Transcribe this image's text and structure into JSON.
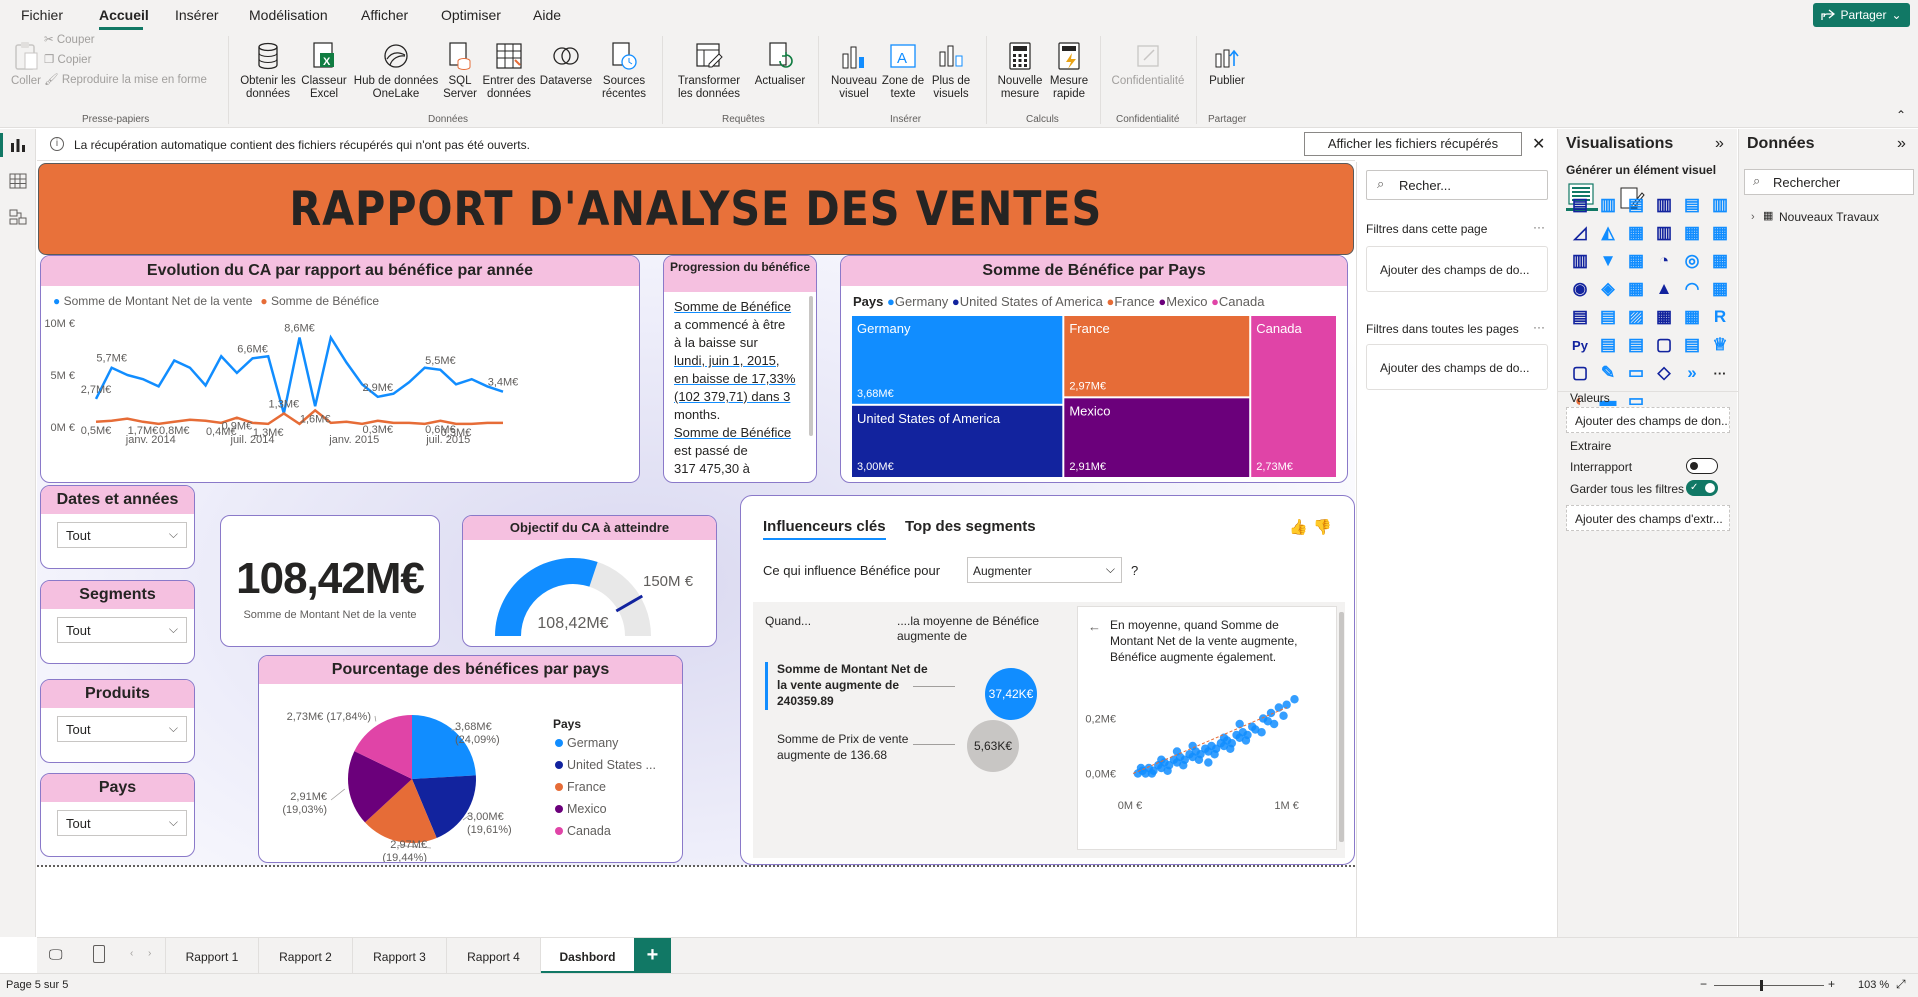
{
  "menu": {
    "items": [
      "Fichier",
      "Accueil",
      "Insérer",
      "Modélisation",
      "Afficher",
      "Optimiser",
      "Aide"
    ],
    "share": "Partager"
  },
  "ribbon": {
    "clipboard": {
      "paste": "Coller",
      "cut": "Couper",
      "copy": "Copier",
      "format_painter": "Reproduire la mise en forme",
      "group": "Presse-papiers"
    },
    "data": {
      "get_data": "Obtenir les données",
      "excel": "Classeur Excel",
      "onelake": "Hub de données OneLake",
      "sql": "SQL Server",
      "enter_data": "Entrer des données",
      "dataverse": "Dataverse",
      "recent": "Sources récentes",
      "group": "Données"
    },
    "queries": {
      "transform": "Transformer les données",
      "refresh": "Actualiser",
      "group": "Requêtes"
    },
    "insert": {
      "new_visual": "Nouveau visuel",
      "textbox": "Zone de texte",
      "more_visuals": "Plus de visuels",
      "group": "Insérer"
    },
    "calc": {
      "new_measure": "Nouvelle mesure",
      "quick_measure": "Mesure rapide",
      "group": "Calculs"
    },
    "sensitivity": {
      "label": "Confidentialité",
      "group": "Confidentialité"
    },
    "share": {
      "publish": "Publier",
      "group": "Partager"
    }
  },
  "notification": {
    "text": "La récupération automatique contient des fichiers récupérés qui n'ont pas été ouverts.",
    "button": "Afficher les fichiers récupérés"
  },
  "report": {
    "title": "RAPPORT D'ANALYSE DES VENTES",
    "line_chart": {
      "title": "Evolution du CA par rapport au bénéfice par année",
      "legend": [
        "Somme de Montant Net de la vente",
        "Somme de Bénéfice"
      ]
    },
    "narrative": {
      "title": "Progression du bénéfice",
      "lines": [
        "Somme de Bénéfice",
        "a commencé à être",
        "à la baisse sur",
        "lundi, juin 1, 2015,",
        "en baisse de 17,33%",
        "(102 379,71) dans 3",
        "months.",
        "Somme de Bénéfice",
        "est passé de",
        "317 475,30 à"
      ]
    },
    "treemap": {
      "title": "Somme de Bénéfice par Pays",
      "legend_title": "Pays"
    },
    "slicers": [
      {
        "title": "Dates et années",
        "value": "Tout"
      },
      {
        "title": "Segments",
        "value": "Tout"
      },
      {
        "title": "Produits",
        "value": "Tout"
      },
      {
        "title": "Pays",
        "value": "Tout"
      }
    ],
    "kpi": {
      "value": "108,42M€",
      "label": "Somme de Montant Net de la vente"
    },
    "gauge": {
      "title": "Objectif du CA à atteindre",
      "value_label": "108,42M€",
      "target_label": "150M €",
      "value": 108.42,
      "target": 150
    },
    "pie": {
      "title": "Pourcentage des bénéfices par pays",
      "legend_title": "Pays"
    },
    "influencers": {
      "tab1": "Influenceurs clés",
      "tab2": "Top des segments",
      "question": "Ce qui influence Bénéfice pour",
      "dropdown": "Augmenter",
      "help": "?",
      "col_when": "Quand...",
      "col_avg": "....la moyenne de Bénéfice augmente de",
      "factor1": "Somme de Montant Net de la vente augmente de 240359.89",
      "bubble1": "37,42K€",
      "factor2": "Somme de Prix de vente augmente de 136.68",
      "bubble2": "5,63K€",
      "detail": "En moyenne, quand Somme de Montant Net de la vente augmente, Bénéfice augmente également.",
      "y_ticks": [
        "0,2M€",
        "0,0M€"
      ],
      "x_ticks": [
        "0M €",
        "1M €"
      ]
    }
  },
  "chart_data": [
    {
      "type": "line",
      "title": "Evolution du CA par rapport au bénéfice par année",
      "x_ticks": [
        "janv. 2014",
        "juil. 2014",
        "janv. 2015",
        "juil. 2015"
      ],
      "y_ticks": [
        "10M €",
        "5M €",
        "0M €"
      ],
      "ylim": [
        0,
        10
      ],
      "series": [
        {
          "name": "Somme de Montant Net de la vente",
          "color": "#118dff",
          "values": [
            2.7,
            5.7,
            5.0,
            4.6,
            3.9,
            6.4,
            5.7,
            4.0,
            6.8,
            5.2,
            6.6,
            6.8,
            1.3,
            8.6,
            2.0,
            8.6,
            6.2,
            4.1,
            2.9,
            3.2,
            4.3,
            5.7,
            5.5,
            4.1,
            4.6,
            3.9,
            3.4
          ]
        },
        {
          "name": "Somme de Bénéfice",
          "color": "#e66c37",
          "values": [
            0.5,
            0.6,
            0.8,
            0.5,
            0.3,
            0.5,
            0.7,
            0.6,
            0.4,
            0.9,
            0.4,
            0.3,
            1.3,
            0.3,
            1.6,
            0.4,
            0.5,
            0.3,
            0.6,
            0.4,
            0.4,
            0.3,
            0.6,
            0.3,
            0.3,
            0.4,
            0.4
          ]
        }
      ],
      "data_labels": [
        {
          "text": "5,7M€",
          "series": 0,
          "index": 1
        },
        {
          "text": "2,7M€",
          "series": 0,
          "index": 0
        },
        {
          "text": "0,5M€",
          "series": 1,
          "index": 0
        },
        {
          "text": "1,7M€",
          "series": 1,
          "index": 3
        },
        {
          "text": "0,8M€",
          "series": 1,
          "index": 5
        },
        {
          "text": "0,4M€",
          "series": 1,
          "index": 8
        },
        {
          "text": "0,9M€",
          "series": 1,
          "index": 9
        },
        {
          "text": "1,3M€",
          "series": 1,
          "index": 11
        },
        {
          "text": "6,6M€",
          "series": 0,
          "index": 10
        },
        {
          "text": "1,3M€",
          "series": 0,
          "index": 12
        },
        {
          "text": "8,6M€",
          "series": 0,
          "index": 13
        },
        {
          "text": "1,6M€",
          "series": 1,
          "index": 14
        },
        {
          "text": "2,9M€",
          "series": 0,
          "index": 18
        },
        {
          "text": "0,3M€",
          "series": 1,
          "index": 18
        },
        {
          "text": "5,5M€",
          "series": 0,
          "index": 22
        },
        {
          "text": "0,6M€",
          "series": 1,
          "index": 22
        },
        {
          "text": "0,3M€",
          "series": 1,
          "index": 23
        },
        {
          "text": "3,4M€",
          "series": 0,
          "index": 26
        }
      ]
    },
    {
      "type": "treemap",
      "title": "Somme de Bénéfice par Pays",
      "categories": [
        "Germany",
        "United States of America",
        "France",
        "Mexico",
        "Canada"
      ],
      "values": [
        3.68,
        3.0,
        2.97,
        2.91,
        2.73
      ],
      "labels": [
        "3,68M€",
        "3,00M€",
        "2,97M€",
        "2,91M€",
        "2,73M€"
      ],
      "colors": [
        "#118dff",
        "#12239e",
        "#e66c37",
        "#6b007b",
        "#e044a7"
      ]
    },
    {
      "type": "pie",
      "title": "Pourcentage des bénéfices par pays",
      "categories": [
        "Germany",
        "United States ...",
        "France",
        "Mexico",
        "Canada"
      ],
      "values": [
        24.09,
        19.61,
        19.44,
        19.03,
        17.84
      ],
      "labels": [
        "3,68M€ (24,09%)",
        "3,00M€ (19,61%)",
        "2,97M€ (19,44%)",
        "2,91M€ (19,03%)",
        "2,73M€ (17,84%)"
      ],
      "colors": [
        "#118dff",
        "#12239e",
        "#e66c37",
        "#6b007b",
        "#e044a7"
      ]
    },
    {
      "type": "scatter",
      "x_ticks": [
        "0M €",
        "1M €"
      ],
      "y_ticks": [
        "0,2M€",
        "0,0M€"
      ],
      "xlim": [
        0,
        1.2
      ],
      "ylim": [
        -0.02,
        0.3
      ],
      "color": "#118dff",
      "points": [
        [
          0.05,
          0.0
        ],
        [
          0.08,
          0.01
        ],
        [
          0.1,
          0.0
        ],
        [
          0.12,
          0.02
        ],
        [
          0.15,
          0.01
        ],
        [
          0.18,
          0.03
        ],
        [
          0.2,
          0.02
        ],
        [
          0.22,
          0.04
        ],
        [
          0.25,
          0.03
        ],
        [
          0.28,
          0.05
        ],
        [
          0.3,
          0.04
        ],
        [
          0.32,
          0.06
        ],
        [
          0.35,
          0.05
        ],
        [
          0.38,
          0.07
        ],
        [
          0.4,
          0.06
        ],
        [
          0.42,
          0.08
        ],
        [
          0.45,
          0.07
        ],
        [
          0.48,
          0.09
        ],
        [
          0.5,
          0.08
        ],
        [
          0.52,
          0.1
        ],
        [
          0.55,
          0.09
        ],
        [
          0.58,
          0.11
        ],
        [
          0.6,
          0.1
        ],
        [
          0.62,
          0.12
        ],
        [
          0.65,
          0.11
        ],
        [
          0.68,
          0.14
        ],
        [
          0.7,
          0.13
        ],
        [
          0.72,
          0.15
        ],
        [
          0.75,
          0.14
        ],
        [
          0.78,
          0.17
        ],
        [
          0.8,
          0.16
        ],
        [
          0.85,
          0.2
        ],
        [
          0.88,
          0.19
        ],
        [
          0.9,
          0.22
        ],
        [
          0.95,
          0.24
        ],
        [
          1.0,
          0.25
        ],
        [
          1.05,
          0.27
        ],
        [
          0.07,
          0.02
        ],
        [
          0.14,
          0.0
        ],
        [
          0.24,
          0.01
        ],
        [
          0.34,
          0.03
        ],
        [
          0.44,
          0.05
        ],
        [
          0.54,
          0.07
        ],
        [
          0.64,
          0.09
        ],
        [
          0.74,
          0.12
        ],
        [
          0.84,
          0.15
        ],
        [
          0.3,
          0.08
        ],
        [
          0.4,
          0.1
        ],
        [
          0.6,
          0.13
        ],
        [
          0.7,
          0.18
        ],
        [
          0.5,
          0.04
        ],
        [
          0.2,
          0.05
        ],
        [
          0.92,
          0.18
        ],
        [
          0.98,
          0.21
        ]
      ]
    }
  ],
  "filters": {
    "search": "Recher...",
    "this_page": "Filtres dans cette page",
    "all_pages": "Filtres dans toutes les pages",
    "add_fields": "Ajouter des champs de do..."
  },
  "viz_pane": {
    "title": "Visualisations",
    "build": "Générer un élément visuel",
    "values_label": "Valeurs",
    "values_add": "Ajouter des champs de don...",
    "drill": "Extraire",
    "cross_report": "Interrapport",
    "keep_filters": "Garder tous les filtres",
    "drill_add": "Ajouter des champs d'extr..."
  },
  "data_pane": {
    "title": "Données",
    "search": "Rechercher",
    "table": "Nouveaux Travaux"
  },
  "tabs": [
    "Rapport 1",
    "Rapport 2",
    "Rapport 3",
    "Rapport 4",
    "Dashbord"
  ],
  "status": {
    "page": "Page 5 sur 5",
    "zoom": "103 %"
  }
}
